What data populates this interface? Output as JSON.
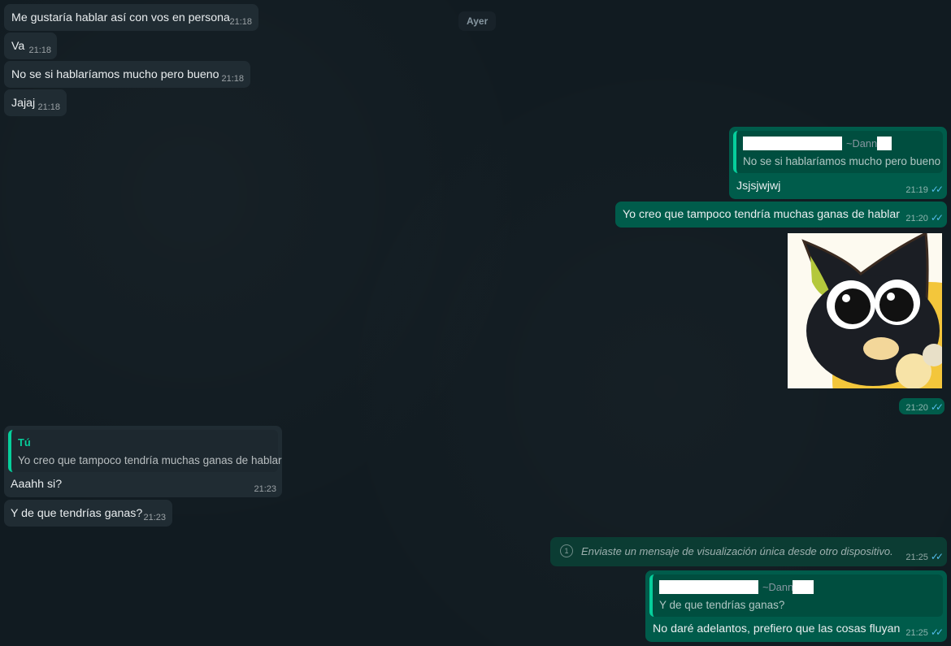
{
  "date_separator": "Ayer",
  "messages": [
    {
      "text": "Me gustaría hablar así con vos en persona",
      "time": "21:18"
    },
    {
      "text": "Va",
      "time": "21:18"
    },
    {
      "text": "No se si hablaríamos mucho pero bueno",
      "time": "21:18"
    },
    {
      "text": "Jajaj",
      "time": "21:18"
    },
    {
      "quote_author": "~Dann",
      "quote_text": "No se si hablaríamos mucho pero bueno",
      "text": "Jsjsjwjwj",
      "time": "21:19"
    },
    {
      "text": "Yo creo que tampoco tendría muchas ganas de hablar",
      "time": "21:20"
    },
    {
      "sticker": "black-cat-sticker",
      "time": "21:20"
    },
    {
      "quote_author": "Tú",
      "quote_text": "Yo creo que tampoco tendría muchas ganas de hablar",
      "text": "Aaahh si?",
      "time": "21:23"
    },
    {
      "text": "Y de que tendrías ganas?",
      "time": "21:23"
    },
    {
      "text": "Enviaste un mensaje de visualización única desde otro dispositivo.",
      "time": "21:25"
    },
    {
      "quote_author": "~Dann",
      "quote_text": "Y de que tendrías ganas?",
      "text": "No daré adelantos, prefiero que las cosas fluyan",
      "time": "21:25"
    }
  ],
  "colors": {
    "background": "#111b21",
    "incoming": "#202c33",
    "outgoing": "#005c4b",
    "read_ticks": "#53bdeb",
    "quote_accent": "#06cf9c"
  },
  "icons": {
    "read": "double-check-icon",
    "view_once": "view-once-icon"
  }
}
